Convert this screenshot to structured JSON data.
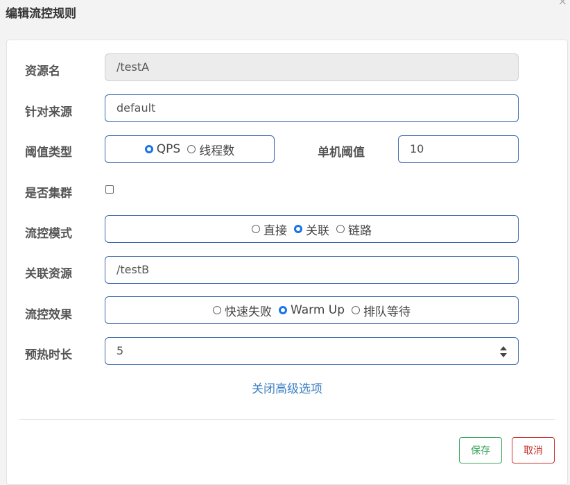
{
  "dialog": {
    "title": "编辑流控规则",
    "close": "×"
  },
  "form": {
    "resource": {
      "label": "资源名",
      "value": "/testA"
    },
    "source": {
      "label": "针对来源",
      "value": "default"
    },
    "threshold_type": {
      "label": "阈值类型",
      "options": [
        "QPS",
        "线程数"
      ],
      "selected": "QPS"
    },
    "single_threshold": {
      "label": "单机阈值",
      "value": "10"
    },
    "cluster": {
      "label": "是否集群",
      "checked": false
    },
    "control_mode": {
      "label": "流控模式",
      "options": [
        "直接",
        "关联",
        "链路"
      ],
      "selected": "关联"
    },
    "related_resource": {
      "label": "关联资源",
      "value": "/testB"
    },
    "control_effect": {
      "label": "流控效果",
      "options": [
        "快速失败",
        "Warm Up",
        "排队等待"
      ],
      "selected": "Warm Up"
    },
    "warmup_time": {
      "label": "预热时长",
      "value": "5"
    },
    "advanced_link": "关闭高级选项"
  },
  "footer": {
    "save": "保存",
    "cancel": "取消"
  },
  "colors": {
    "border": "#3a67a8",
    "radio_checked": "#1a73e8",
    "link": "#3b7fc4",
    "save": "#3aa55b",
    "cancel": "#c9302c"
  }
}
